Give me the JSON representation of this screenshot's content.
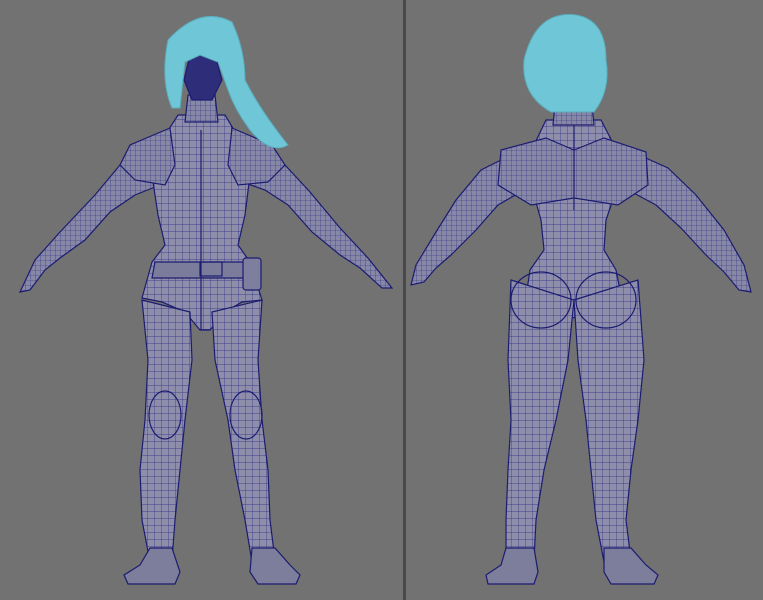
{
  "viewports": {
    "front": {
      "name": "front-view",
      "hair_color": "#6fc6d6",
      "mesh_fill": "#8c8ca8",
      "wire_color": "#1f1f7a"
    },
    "back": {
      "name": "back-view",
      "hair_color": "#6fc6d6",
      "mesh_fill": "#8c8ca8",
      "wire_color": "#1f1f7a"
    }
  },
  "background_color": "#727272"
}
